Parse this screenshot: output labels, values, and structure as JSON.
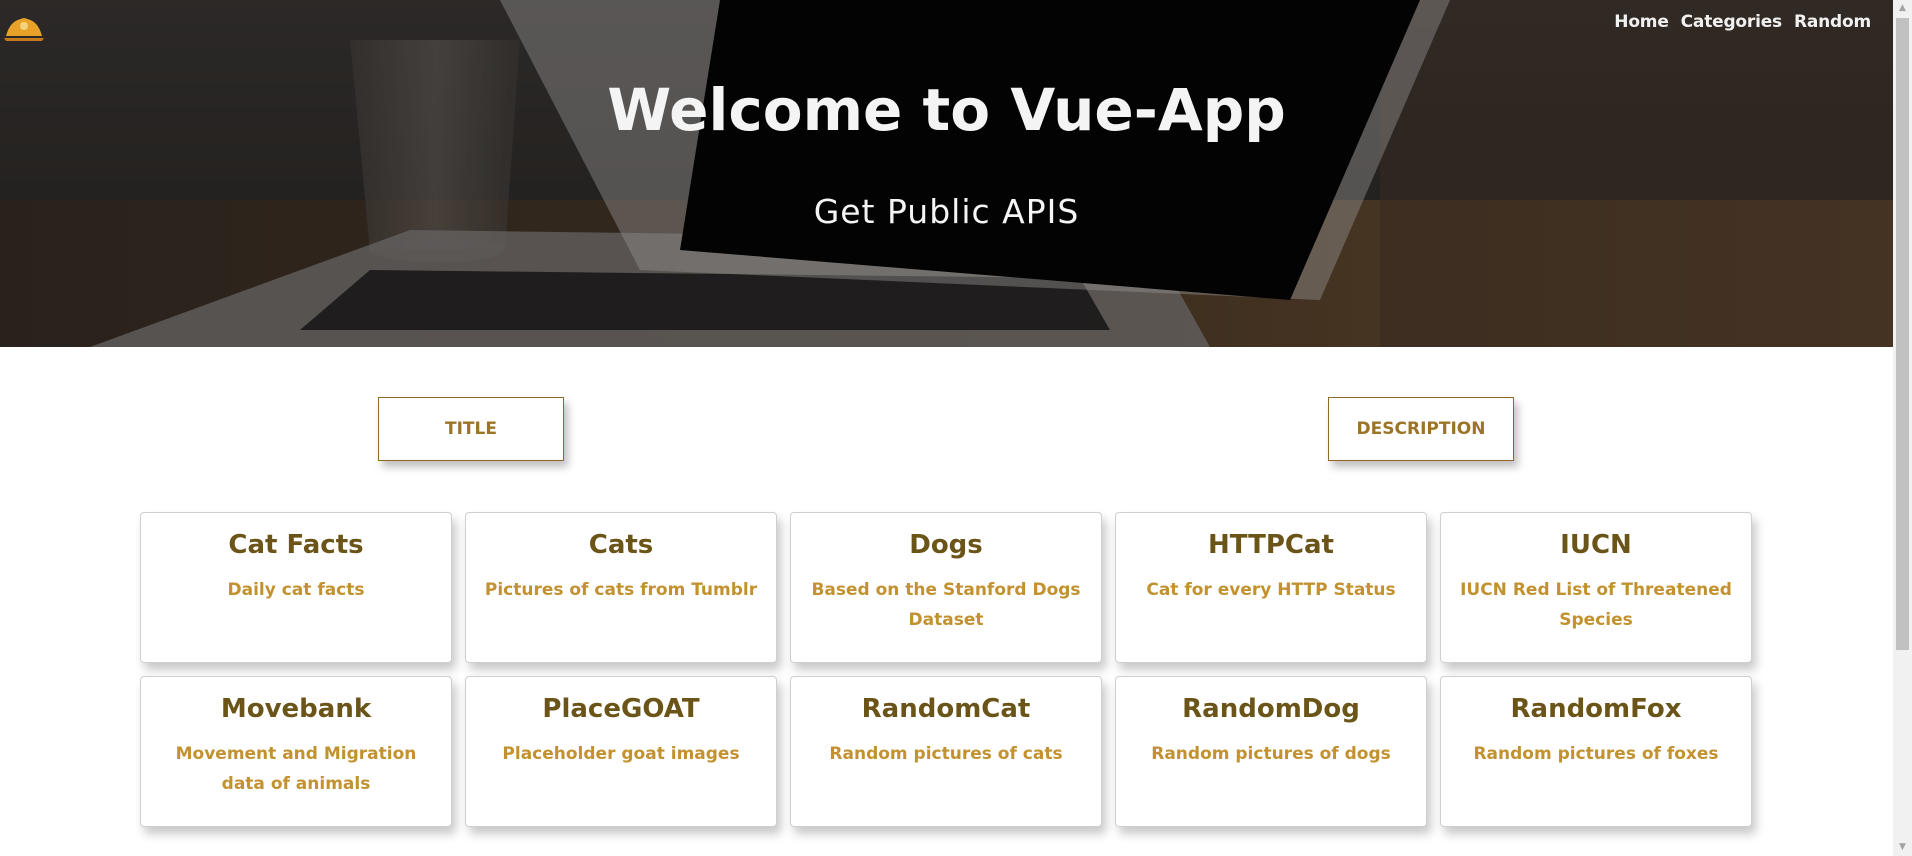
{
  "nav": {
    "home": "Home",
    "categories": "Categories",
    "random": "Random"
  },
  "hero": {
    "title": "Welcome to Vue-App",
    "subtitle": "Get Public APIS"
  },
  "sort": {
    "title_label": "TITLE",
    "description_label": "DESCRIPTION"
  },
  "cards": [
    {
      "title": "Cat Facts",
      "description": "Daily cat facts"
    },
    {
      "title": "Cats",
      "description": "Pictures of cats from Tumblr"
    },
    {
      "title": "Dogs",
      "description": "Based on the Stanford Dogs Dataset"
    },
    {
      "title": "HTTPCat",
      "description": "Cat for every HTTP Status"
    },
    {
      "title": "IUCN",
      "description": "IUCN Red List of Threatened Species"
    },
    {
      "title": "Movebank",
      "description": "Movement and Migration data of animals"
    },
    {
      "title": "PlaceGOAT",
      "description": "Placeholder goat images"
    },
    {
      "title": "RandomCat",
      "description": "Random pictures of cats"
    },
    {
      "title": "RandomDog",
      "description": "Random pictures of dogs"
    },
    {
      "title": "RandomFox",
      "description": "Random pictures of foxes"
    }
  ],
  "icons": {
    "logo": "site-logo",
    "hero_background": "laptop-photo",
    "scroll_up": "scroll-up-arrow",
    "scroll_down": "scroll-down-arrow"
  },
  "colors": {
    "accent": "#9b7426",
    "card_title": "#6b5418",
    "card_description": "#c39230",
    "nav_text": "#f1f1f1"
  }
}
